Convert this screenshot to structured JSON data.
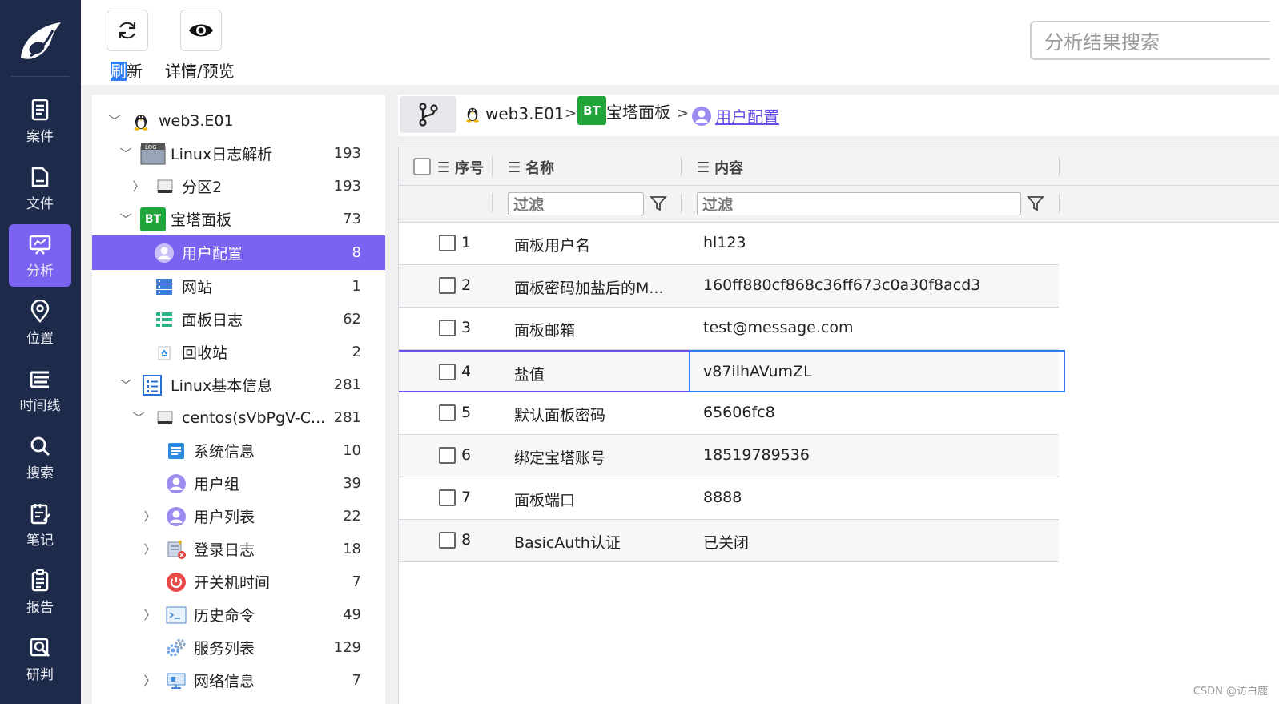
{
  "nav": {
    "items": [
      {
        "label": "案件",
        "icon": "case-icon"
      },
      {
        "label": "文件",
        "icon": "file-icon"
      },
      {
        "label": "分析",
        "icon": "analysis-icon"
      },
      {
        "label": "位置",
        "icon": "location-icon"
      },
      {
        "label": "时间线",
        "icon": "timeline-icon"
      },
      {
        "label": "搜索",
        "icon": "search-icon"
      },
      {
        "label": "笔记",
        "icon": "note-icon"
      },
      {
        "label": "报告",
        "icon": "report-icon"
      },
      {
        "label": "研判",
        "icon": "judge-icon"
      }
    ],
    "active_index": 2
  },
  "toolbar": {
    "refresh_label_highlight": "刷",
    "refresh_label_rest": "新",
    "preview_label": "详情/预览",
    "search_placeholder": "分析结果搜索"
  },
  "tree": {
    "items": [
      {
        "name": "web3.E01",
        "count": ""
      },
      {
        "name": "Linux日志解析",
        "count": "193"
      },
      {
        "name": "分区2",
        "count": "193"
      },
      {
        "name": "宝塔面板",
        "count": "73"
      },
      {
        "name": "用户配置",
        "count": "8"
      },
      {
        "name": "网站",
        "count": "1"
      },
      {
        "name": "面板日志",
        "count": "62"
      },
      {
        "name": "回收站",
        "count": "2"
      },
      {
        "name": "Linux基本信息",
        "count": "281"
      },
      {
        "name": "centos(sVbPgV-C...",
        "count": "281"
      },
      {
        "name": "系统信息",
        "count": "10"
      },
      {
        "name": "用户组",
        "count": "39"
      },
      {
        "name": "用户列表",
        "count": "22"
      },
      {
        "name": "登录日志",
        "count": "18"
      },
      {
        "name": "开关机时间",
        "count": "7"
      },
      {
        "name": "历史命令",
        "count": "49"
      },
      {
        "name": "服务列表",
        "count": "129"
      },
      {
        "name": "网络信息",
        "count": "7"
      }
    ],
    "bt_badge": "BT"
  },
  "breadcrumb": {
    "items": [
      "web3.E01",
      "宝塔面板",
      "用户配置"
    ],
    "sep": ">"
  },
  "grid": {
    "columns": [
      "序号",
      "名称",
      "内容"
    ],
    "filter_placeholder": "过滤",
    "rows": [
      {
        "num": "1",
        "name": "面板用户名",
        "content": "hl123"
      },
      {
        "num": "2",
        "name": "面板密码加盐后的M...",
        "content": "160ff880cf868c36ff673c0a30f8acd3"
      },
      {
        "num": "3",
        "name": "面板邮箱",
        "content": "test@message.com"
      },
      {
        "num": "4",
        "name": "盐值",
        "content": "v87ilhAVumZL"
      },
      {
        "num": "5",
        "name": "默认面板密码",
        "content": "65606fc8"
      },
      {
        "num": "6",
        "name": "绑定宝塔账号",
        "content": "18519789536"
      },
      {
        "num": "7",
        "name": "面板端口",
        "content": "8888"
      },
      {
        "num": "8",
        "name": "BasicAuth认证",
        "content": "已关闭"
      }
    ],
    "focused_row": 3
  },
  "watermark": "CSDN @访白鹿",
  "colors": {
    "nav_bg": "#1e2a4a",
    "accent": "#7a63f0",
    "focus_blue": "#2e7df5"
  }
}
